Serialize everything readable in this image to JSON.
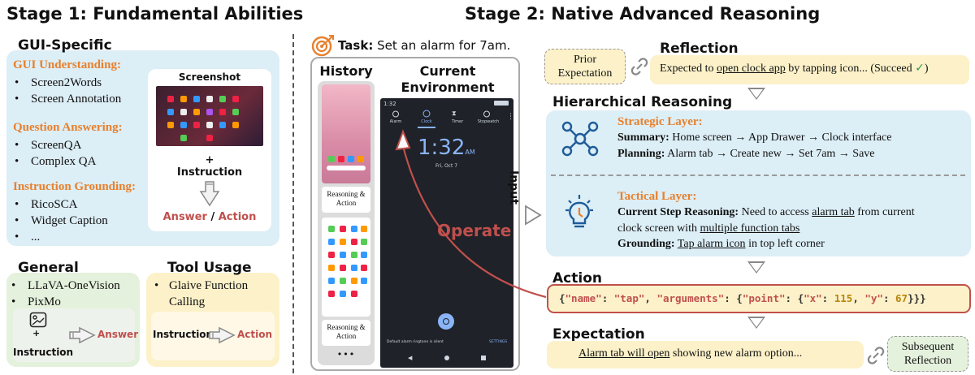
{
  "stage1": {
    "title": "Stage 1: Fundamental Abilities",
    "gui_specific": {
      "title": "GUI-Specific",
      "groups": [
        {
          "heading": "GUI Understanding:",
          "items": [
            "Screen2Words",
            "Screen Annotation"
          ]
        },
        {
          "heading": "Question Answering:",
          "items": [
            "ScreenQA",
            "Complex QA"
          ]
        },
        {
          "heading": "Instruction Grounding:",
          "items": [
            "RicoSCA",
            "Widget Caption",
            "..."
          ]
        }
      ],
      "screenshot_label": "Screenshot",
      "plus": "+",
      "instruction": "Instruction",
      "answer": "Answer",
      "slash": " / ",
      "action": "Action"
    },
    "general": {
      "title": "General",
      "items": [
        "LLaVA-OneVision",
        "PixMo"
      ],
      "plus": "+",
      "instruction": "Instruction",
      "answer": "Answer"
    },
    "tool_usage": {
      "title": "Tool Usage",
      "item": "Glaive Function Calling",
      "instruction": "Instruction",
      "action": "Action"
    }
  },
  "stage2": {
    "title": "Stage 2: Native Advanced Reasoning",
    "task_label": "Task:",
    "task_text": "Set an alarm for 7am.",
    "history_label": "History",
    "current_env_label": "Current Environment",
    "reasoning_action": "Reasoning & Action",
    "ellipsis": "•••",
    "phone": {
      "status_time": "1:32",
      "tabs": [
        "Alarm",
        "Clock",
        "Timer",
        "Stopwatch"
      ],
      "clock_time": "1:32",
      "clock_ampm": "AM",
      "date": "Fri, Oct 7",
      "footer_text": "Default alarm ringtone is silent",
      "footer_action": "SETTINGS"
    },
    "operate_label": "Operate",
    "input_label": "Input",
    "prior_expectation": "Prior Expectation",
    "reflection": {
      "title": "Reflection",
      "text_pre": "Expected to ",
      "text_underlined": "open clock app",
      "text_post": " by tapping icon... (Succeed ",
      "check": "✓",
      "close_paren": ")"
    },
    "hierarchical": {
      "title": "Hierarchical Reasoning",
      "strategic": {
        "title": "Strategic Layer:",
        "summary_label": "Summary:",
        "summary_text": "Home screen → App Drawer → Clock interface",
        "planning_label": "Planning:",
        "planning_text": "Alarm tab → Create new → Set 7am → Save"
      },
      "tactical": {
        "title": "Tactical Layer:",
        "csr_label": "Current Step Reasoning:",
        "csr_pre": "Need to access ",
        "csr_u1": "alarm tab",
        "csr_mid": " from current",
        "csr_line2_pre": "clock screen with ",
        "csr_u2": "multiple function tabs",
        "grounding_label": "Grounding:",
        "grounding_u": "Tap alarm icon",
        "grounding_post": " in top left corner"
      }
    },
    "action": {
      "title": "Action",
      "code": {
        "open1": "{",
        "k_name": "\"name\"",
        "colon1": ": ",
        "v_tap": "\"tap\"",
        "comma1": ", ",
        "k_args": "\"arguments\"",
        "colon2": ": {",
        "k_point": "\"point\"",
        "colon3": ": {",
        "k_x": "\"x\"",
        "colon4": ": ",
        "v_x": "115",
        "comma2": ", ",
        "k_y": "\"y\"",
        "colon5": ": ",
        "v_y": "67",
        "close": "}}}"
      }
    },
    "expectation": {
      "title": "Expectation",
      "text_underlined": "Alarm tab will open",
      "text_post": " showing new alarm option...",
      "subsequent_reflection": "Subsequent Reflection"
    }
  },
  "colors": {
    "orange": "#E8802C",
    "blue_box": "#DCEEF6",
    "green_box": "#E4F1DC",
    "yellow_box": "#FCF1C9",
    "red_arrow": "#C0504D",
    "action_border": "#C0504D",
    "phone_bg": "#1F2228",
    "code_key": "#C0504D",
    "code_num": "#B8860B"
  }
}
